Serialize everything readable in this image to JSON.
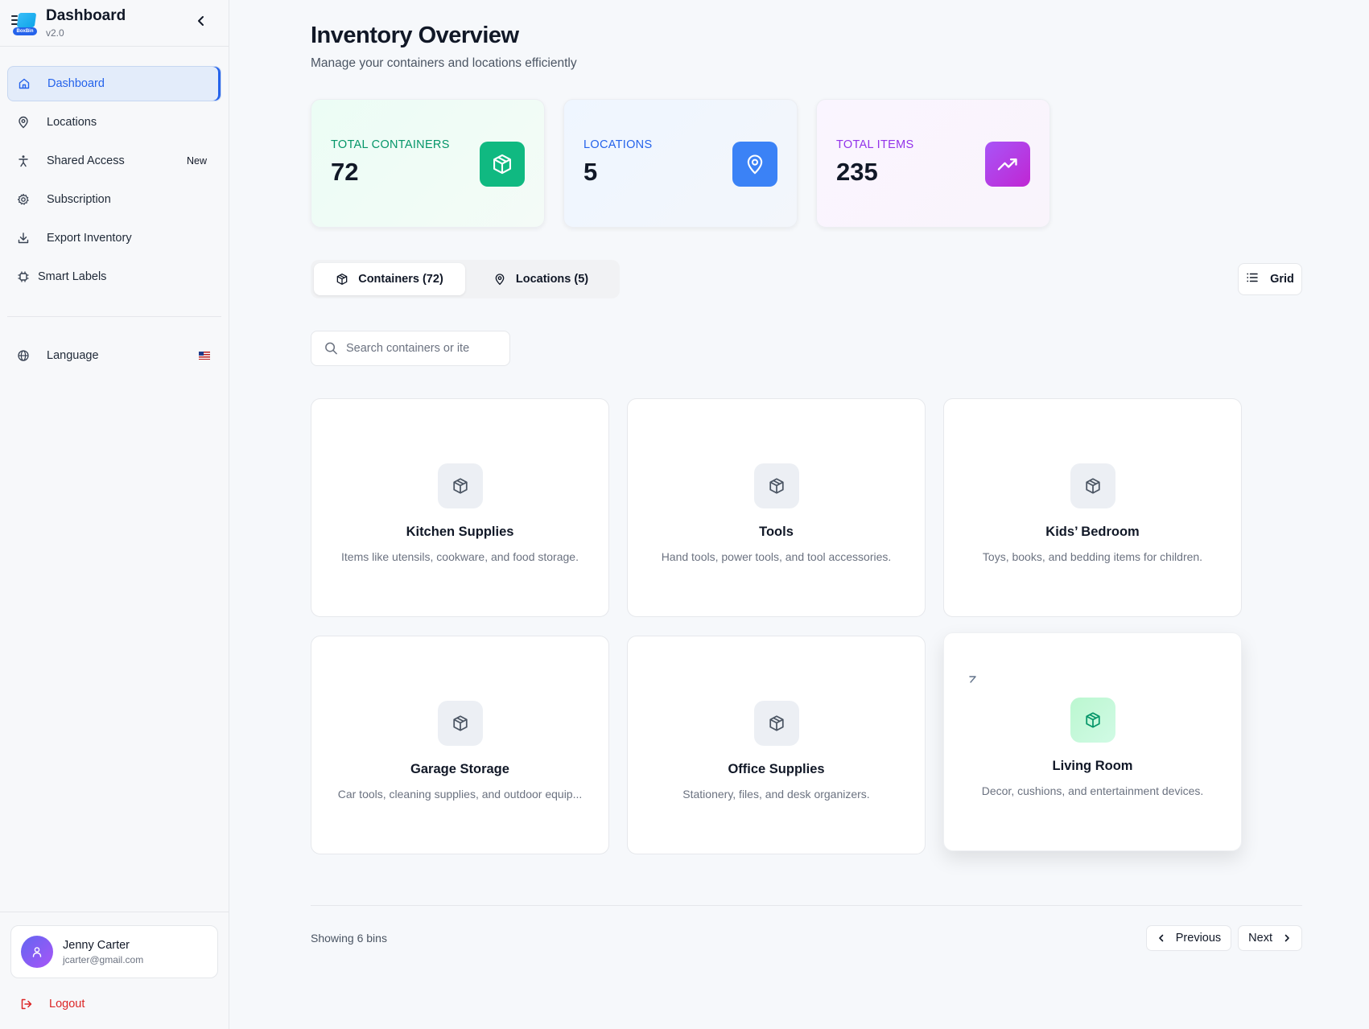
{
  "app": {
    "title": "Dashboard",
    "version": "v2.0",
    "logo_tag": "BoxBin"
  },
  "sidebar": {
    "items": [
      {
        "label": "Dashboard",
        "icon": "home-icon",
        "active": true
      },
      {
        "label": "Locations",
        "icon": "map-pin-icon"
      },
      {
        "label": "Shared Access",
        "icon": "person-icon",
        "badge": "New"
      },
      {
        "label": "Subscription",
        "icon": "gear-icon"
      },
      {
        "label": "Export Inventory",
        "icon": "download-icon"
      },
      {
        "label": "Smart Labels",
        "icon": "chip-icon"
      }
    ],
    "language": {
      "label": "Language",
      "icon": "globe-icon",
      "flag": "us-flag-icon"
    },
    "user": {
      "name": "Jenny Carter",
      "email": "jcarter@gmail.com"
    },
    "logout": "Logout"
  },
  "page": {
    "title": "Inventory Overview",
    "subtitle": "Manage your containers and locations efficiently"
  },
  "stats": [
    {
      "label": "TOTAL CONTAINERS",
      "value": "72",
      "icon": "box-icon",
      "color": "#10b981"
    },
    {
      "label": "LOCATIONS",
      "value": "5",
      "icon": "map-pin-icon",
      "color": "#3b82f6"
    },
    {
      "label": "TOTAL ITEMS",
      "value": "235",
      "icon": "trending-up-icon",
      "color": "#a855f7"
    }
  ],
  "tabs": [
    {
      "label": "Containers (72)",
      "icon": "box-icon",
      "active": true
    },
    {
      "label": "Locations (5)",
      "icon": "map-pin-icon"
    }
  ],
  "view_toggle": {
    "label": "Grid",
    "icon": "list-icon"
  },
  "search": {
    "placeholder": "Search containers or ite",
    "value": ""
  },
  "containers": [
    {
      "name": "Kitchen Supplies",
      "description": "Items like utensils, cookware, and food storage."
    },
    {
      "name": "Tools",
      "description": "Hand tools, power tools, and tool accessories."
    },
    {
      "name": "Kids’ Bedroom",
      "description": "Toys, books, and bedding items for children."
    },
    {
      "name": "Garage Storage",
      "description": "Car tools, cleaning supplies, and outdoor equip..."
    },
    {
      "name": "Office Supplies",
      "description": "Stationery, files, and desk organizers."
    },
    {
      "name": "Living Room",
      "description": "Decor, cushions, and entertainment devices."
    }
  ],
  "footer": {
    "showing": "Showing 6 bins",
    "previous": "Previous",
    "next": "Next"
  }
}
